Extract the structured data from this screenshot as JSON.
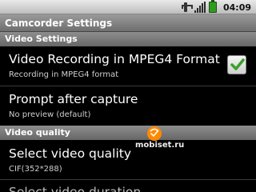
{
  "status_bar": {
    "time": "04:09",
    "icons": [
      "usb-icon",
      "signal-icon",
      "battery-icon"
    ]
  },
  "title_bar": {
    "title": "Camcorder Settings"
  },
  "sections": [
    {
      "header": "Video Settings",
      "items": [
        {
          "title": "Video Recording in MPEG4 Format",
          "summary": "Recording in MPEG4 format",
          "checked": true
        },
        {
          "title": "Prompt after capture",
          "summary": "No preview (default)"
        }
      ]
    },
    {
      "header": "Video quality",
      "items": [
        {
          "title": "Select video quality",
          "summary": "CIF(352*288)"
        },
        {
          "title": "Select video duration"
        }
      ]
    }
  ],
  "watermark": {
    "text": "mobiset.ru",
    "icon": "mobiset-logo-icon"
  },
  "colors": {
    "check_accent": "#3aa02b",
    "logo_orange": "#ff8a00"
  }
}
